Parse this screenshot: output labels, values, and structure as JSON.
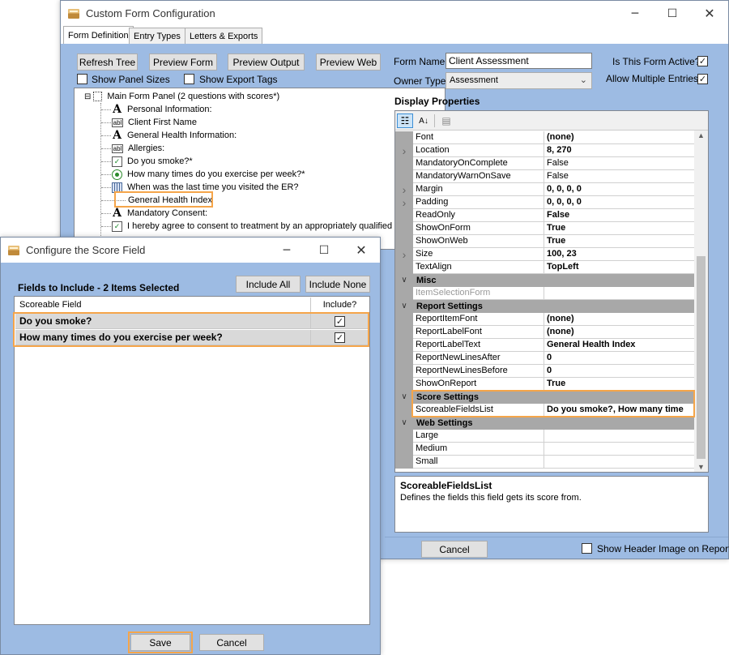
{
  "main_window": {
    "title": "Custom Form Configuration",
    "tabs": [
      {
        "label": "Form Definition"
      },
      {
        "label": "Entry Types"
      },
      {
        "label": "Letters & Exports"
      }
    ],
    "toolbar": {
      "refresh_tree": "Refresh Tree",
      "preview_form": "Preview Form",
      "preview_output": "Preview Output",
      "preview_web": "Preview Web"
    },
    "show_panel_sizes": {
      "label": "Show Panel Sizes",
      "checked": false
    },
    "show_export_tags": {
      "label": "Show Export Tags",
      "checked": false
    },
    "tree": {
      "root": "Main Form Panel (2 questions with scores*)",
      "items": [
        {
          "icon": "text-label-icon",
          "label": "Personal Information:"
        },
        {
          "icon": "textbox-icon",
          "label": "Client First Name"
        },
        {
          "icon": "text-label-icon",
          "label": "General Health Information:"
        },
        {
          "icon": "textbox-icon",
          "label": "Allergies:"
        },
        {
          "icon": "checkbox-icon",
          "label": "Do you smoke?*"
        },
        {
          "icon": "radio-icon",
          "label": "How many times do you exercise per week?*"
        },
        {
          "icon": "calendar-icon",
          "label": "When was the last time you visited the ER?"
        },
        {
          "icon": "",
          "label": "General Health Index"
        },
        {
          "icon": "text-label-icon",
          "label": "Mandatory Consent:"
        },
        {
          "icon": "checkbox-icon",
          "label": "I hereby agree to consent to treatment by an appropriately qualified"
        }
      ]
    },
    "form_name": {
      "label": "Form Name",
      "value": "Client Assessment"
    },
    "owner_type": {
      "label": "Owner Type",
      "value": "Assessment"
    },
    "is_active": {
      "label": "Is This Form Active?",
      "checked": true
    },
    "allow_multiple": {
      "label": "Allow Multiple Entries?",
      "checked": true
    },
    "display_properties_label": "Display Properties",
    "properties": [
      {
        "name": "Font",
        "value": "(none)",
        "bold": true
      },
      {
        "name": "Location",
        "value": "8, 270",
        "bold": true,
        "expandable": true
      },
      {
        "name": "MandatoryOnComplete",
        "value": "False"
      },
      {
        "name": "MandatoryWarnOnSave",
        "value": "False"
      },
      {
        "name": "Margin",
        "value": "0, 0, 0, 0",
        "bold": true,
        "expandable": true
      },
      {
        "name": "Padding",
        "value": "0, 0, 0, 0",
        "bold": true,
        "expandable": true
      },
      {
        "name": "ReadOnly",
        "value": "False",
        "bold": true
      },
      {
        "name": "ShowOnForm",
        "value": "True",
        "bold": true
      },
      {
        "name": "ShowOnWeb",
        "value": "True",
        "bold": true
      },
      {
        "name": "Size",
        "value": "100, 23",
        "bold": true,
        "expandable": true
      },
      {
        "name": "TextAlign",
        "value": "TopLeft",
        "bold": true
      },
      {
        "category": "Misc"
      },
      {
        "name": "ItemSelectionForm",
        "value": "",
        "disabled": true
      },
      {
        "category": "Report Settings"
      },
      {
        "name": "ReportItemFont",
        "value": "(none)",
        "bold": true
      },
      {
        "name": "ReportLabelFont",
        "value": "(none)",
        "bold": true
      },
      {
        "name": "ReportLabelText",
        "value": "General Health Index",
        "bold": true
      },
      {
        "name": "ReportNewLinesAfter",
        "value": "0",
        "bold": true
      },
      {
        "name": "ReportNewLinesBefore",
        "value": "0",
        "bold": true
      },
      {
        "name": "ShowOnReport",
        "value": "True",
        "bold": true
      },
      {
        "category": "Score Settings"
      },
      {
        "name": "ScoreableFieldsList",
        "value": "Do you smoke?, How many time",
        "bold": true
      },
      {
        "category": "Web Settings"
      },
      {
        "name": "Large",
        "value": ""
      },
      {
        "name": "Medium",
        "value": ""
      },
      {
        "name": "Small",
        "value": ""
      }
    ],
    "description": {
      "title": "ScoreableFieldsList",
      "text": "Defines the fields this field gets its score from."
    },
    "cancel": "Cancel",
    "show_header_image": {
      "label": "Show Header Image on Report?",
      "checked": false
    }
  },
  "score_dialog": {
    "title": "Configure the Score Field",
    "fields_label": "Fields to Include - 2 Items Selected",
    "include_all": "Include All",
    "include_none": "Include None",
    "columns": [
      "Scoreable Field",
      "Include?"
    ],
    "rows": [
      {
        "field": "Do you smoke?",
        "include": true
      },
      {
        "field": "How many times do you exercise per week?",
        "include": true
      }
    ],
    "save": "Save",
    "cancel": "Cancel"
  },
  "colors": {
    "window_bg": "#9dbbe3",
    "highlight": "#f5a54a",
    "category_gray": "#a8a8a8"
  }
}
